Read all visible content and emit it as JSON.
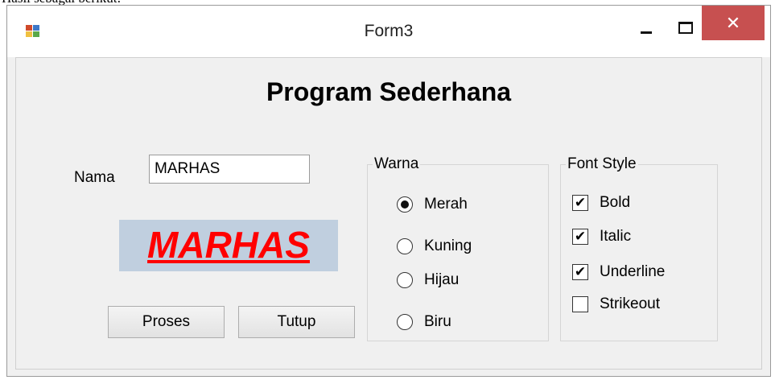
{
  "window": {
    "title": "Form3",
    "controls": {
      "minimize_icon": "minimize-icon",
      "maximize_icon": "maximize-icon",
      "close_label": "✕",
      "close_color": "#c75050"
    }
  },
  "caption_fragment": "Hasil sebagai berikut:",
  "form": {
    "heading": "Program Sederhana",
    "nama_label": "Nama",
    "nama_value": "MARHAS",
    "display_text": "MARHAS",
    "display_color": "#ff0000",
    "display_background": "#c0cfdf",
    "proses_label": "Proses",
    "tutup_label": "Tutup"
  },
  "warna": {
    "title": "Warna",
    "options": [
      {
        "label": "Merah",
        "checked": true
      },
      {
        "label": "Kuning",
        "checked": false
      },
      {
        "label": "Hijau",
        "checked": false
      },
      {
        "label": "Biru",
        "checked": false
      }
    ]
  },
  "font_style": {
    "title": "Font Style",
    "options": [
      {
        "label": "Bold",
        "checked": true
      },
      {
        "label": "Italic",
        "checked": true
      },
      {
        "label": "Underline",
        "checked": true
      },
      {
        "label": "Strikeout",
        "checked": false
      }
    ]
  }
}
